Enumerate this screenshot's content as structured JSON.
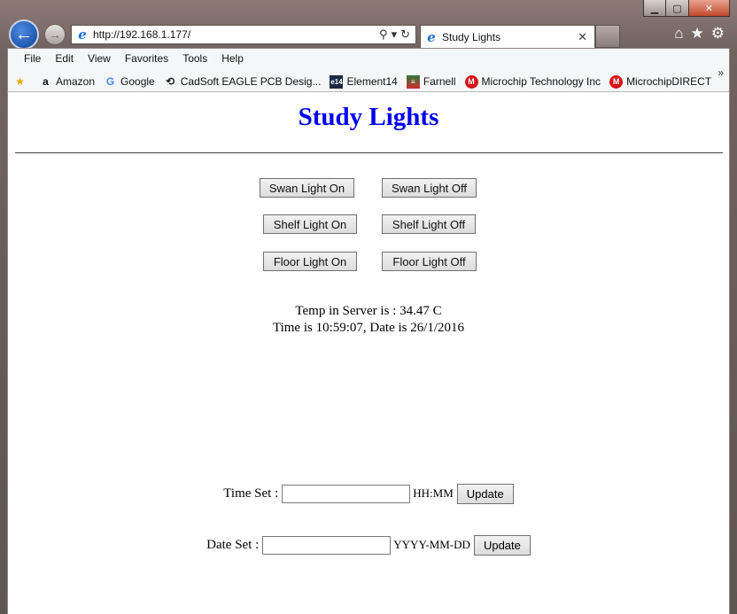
{
  "browser": {
    "address_url": "http://192.168.1.177/",
    "tab_title": "Study Lights",
    "menu": [
      "File",
      "Edit",
      "View",
      "Favorites",
      "Tools",
      "Help"
    ],
    "favorites": [
      {
        "label": "Amazon",
        "icon": "amazon-icon"
      },
      {
        "label": "Google",
        "icon": "google-icon"
      },
      {
        "label": "CadSoft EAGLE PCB Desig...",
        "icon": "cadsoft-icon"
      },
      {
        "label": "Element14",
        "icon": "element14-icon"
      },
      {
        "label": "Farnell",
        "icon": "farnell-icon"
      },
      {
        "label": "Microchip Technology Inc",
        "icon": "microchip-icon"
      },
      {
        "label": "MicrochipDIRECT",
        "icon": "microchip-icon"
      }
    ],
    "overflow_glyph": "»"
  },
  "page": {
    "title": "Study Lights",
    "buttons": [
      {
        "on": "Swan Light On",
        "off": "Swan Light Off"
      },
      {
        "on": "Shelf Light On",
        "off": "Shelf Light Off"
      },
      {
        "on": "Floor Light On",
        "off": "Floor Light Off"
      }
    ],
    "temp_line": "Temp in Server is : 34.47 C",
    "time_line": "Time is 10:59:07, Date is 26/1/2016",
    "time_set": {
      "label": "Time Set :",
      "value": "",
      "format": "HH:MM",
      "button": "Update"
    },
    "date_set": {
      "label": "Date Set :",
      "value": "",
      "format": "YYYY-MM-DD",
      "button": "Update"
    }
  },
  "colors": {
    "title": "#0000ee"
  }
}
